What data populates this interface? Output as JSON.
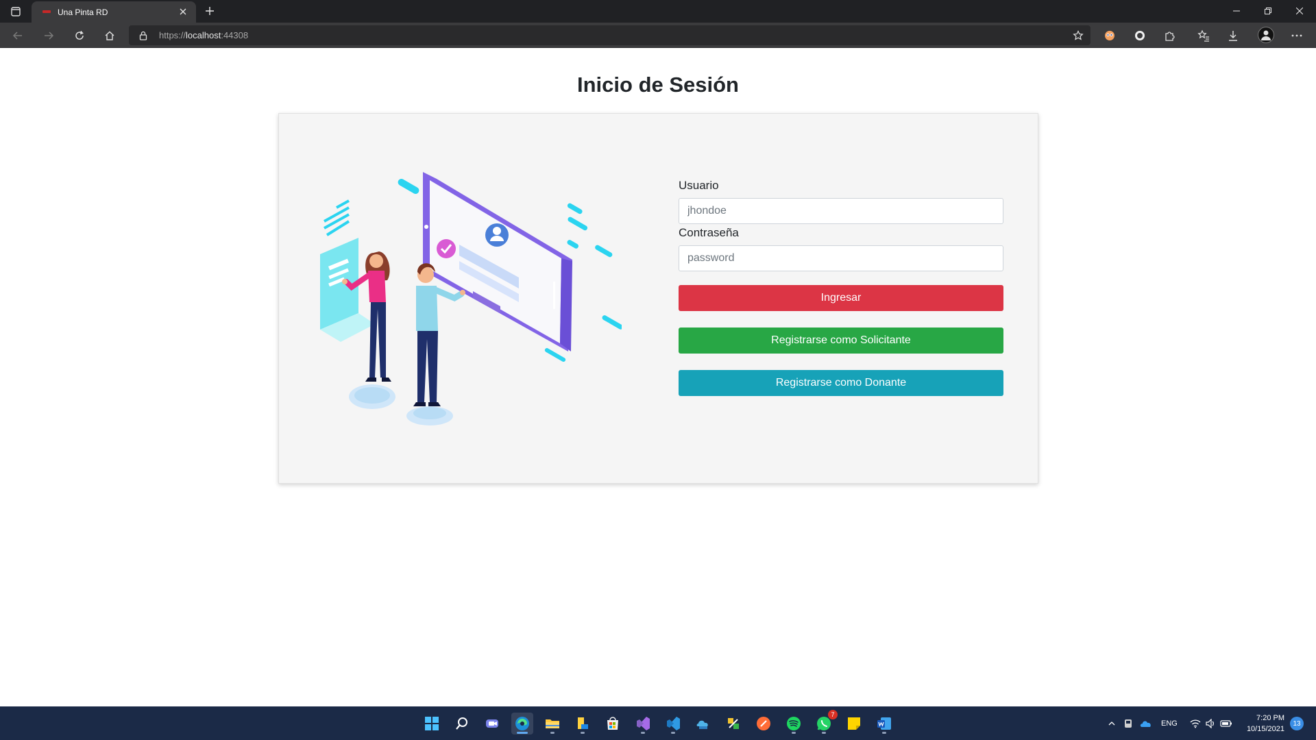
{
  "browser": {
    "tab_title": "Una Pinta RD",
    "url_scheme": "https://",
    "url_host": "localhost",
    "url_port": ":44308"
  },
  "page": {
    "title": "Inicio de Sesión"
  },
  "login_form": {
    "username_label": "Usuario",
    "username_placeholder": "jhondoe",
    "password_label": "Contraseña",
    "password_placeholder": "password",
    "login_button": "Ingresar",
    "register_requester_button": "Registrarse como Solicitante",
    "register_donor_button": "Registrarse como Donante"
  },
  "colors": {
    "login_button": "#dc3545",
    "register_requester_button": "#28a745",
    "register_donor_button": "#17a2b8",
    "card_background": "#f5f5f5"
  },
  "taskbar": {
    "apps": [
      "start-icon",
      "search-icon",
      "teams-chat-icon",
      "edge-icon",
      "file-explorer-icon",
      "file-manager-icon",
      "store-icon",
      "visual-studio-icon",
      "vscode-icon",
      "azure-data-studio-icon",
      "sql-tool-icon",
      "postman-icon",
      "spotify-icon",
      "whatsapp-icon",
      "sticky-notes-icon",
      "word-icon"
    ],
    "whatsapp_badge": "7",
    "language": "ENG",
    "time": "7:20 PM",
    "date": "10/15/2021",
    "notifications": "13"
  }
}
